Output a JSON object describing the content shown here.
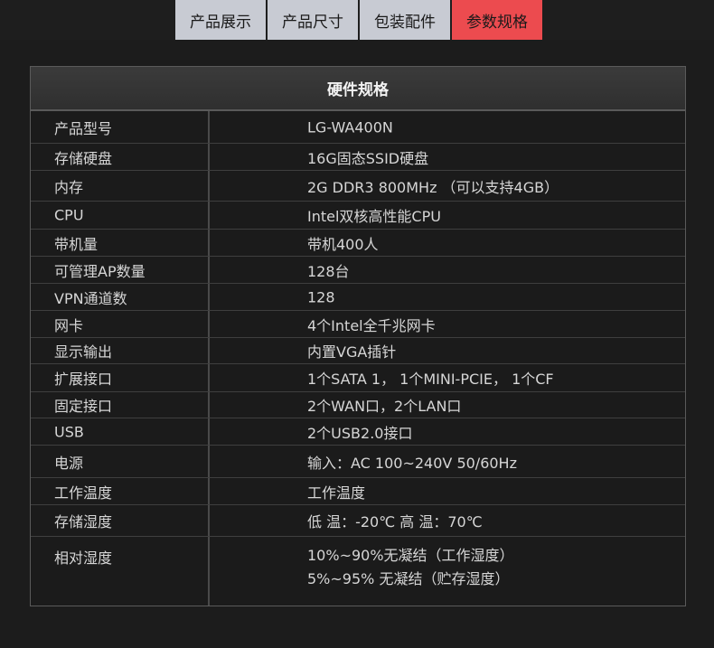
{
  "tabs": [
    {
      "label": "产品展示",
      "active": false
    },
    {
      "label": "产品尺寸",
      "active": false
    },
    {
      "label": "包装配件",
      "active": false
    },
    {
      "label": "参数规格",
      "active": true
    }
  ],
  "colors": {
    "active_tab": "#ec4b4f",
    "inactive_tab": "#c8cbd3",
    "background": "#1c1c1c"
  },
  "spec_table": {
    "title": "硬件规格",
    "rows": [
      {
        "label": "产品型号",
        "value": "LG-WA400N"
      },
      {
        "label": "存储硬盘",
        "value": "16G固态SSID硬盘"
      },
      {
        "label": "内存",
        "value": "2G DDR3 800MHz （可以支持4GB）"
      },
      {
        "label": "CPU",
        "value": "Intel双核高性能CPU"
      },
      {
        "label": "带机量",
        "value": "带机400人"
      },
      {
        "label": "可管理AP数量",
        "value": "128台"
      },
      {
        "label": "VPN通道数",
        "value": "128"
      },
      {
        "label": "网卡",
        "value": "4个Intel全千兆网卡"
      },
      {
        "label": "显示输出",
        "value": "内置VGA插针"
      },
      {
        "label": "扩展接口",
        "value": "1个SATA 1， 1个MINI-PCIE， 1个CF"
      },
      {
        "label": "固定接口",
        "value": "2个WAN口，2个LAN口"
      },
      {
        "label": "USB",
        "value": "2个USB2.0接口"
      },
      {
        "label": "电源",
        "value": "输入：AC 100~240V  50/60Hz"
      },
      {
        "label": "工作温度",
        "value": "工作温度"
      },
      {
        "label": "存储湿度",
        "value": "低 温：-20℃        高 温：70℃"
      },
      {
        "label": "相对湿度",
        "value_lines": [
          "10%~90%无凝结（工作湿度）",
          "5%~95% 无凝结（贮存湿度）"
        ]
      }
    ]
  }
}
